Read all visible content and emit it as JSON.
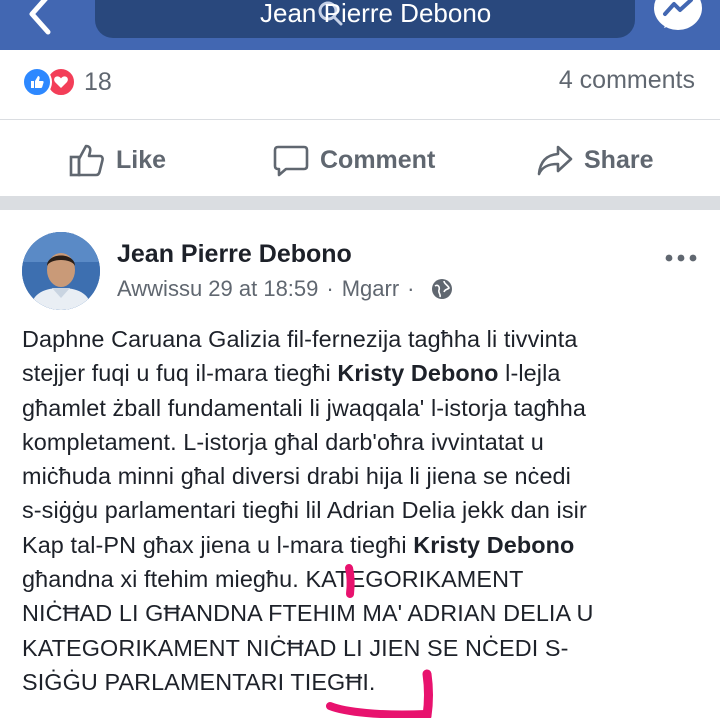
{
  "header": {
    "search_text": "Jean Pierre Debono",
    "colors": {
      "bar": "#4267b2",
      "search_box": "#29487d"
    }
  },
  "icons": [
    "back-arrow-icon",
    "search-icon",
    "messenger-icon",
    "like-reaction-icon",
    "love-reaction-icon",
    "thumbs-up-icon",
    "comment-icon",
    "share-icon",
    "globe-icon",
    "more-options-icon"
  ],
  "engagement": {
    "reaction_count": "18",
    "comments_count": "4 comments"
  },
  "actions": {
    "like": "Like",
    "comment": "Comment",
    "share": "Share"
  },
  "post": {
    "author": "Jean Pierre Debono",
    "date": "Awwissu 29 at 18:59",
    "separator": "·",
    "location": "Mgarr",
    "lines": [
      [
        "Daphne Caruana Galizia fil-fernezija tagħha li tivvinta",
        "",
        ""
      ],
      [
        "stejjer fuqi u fuq il-mara tiegħi ",
        "Kristy Debono",
        " l-lejla"
      ],
      [
        "għamlet żball fundamentali li jwaqqala' l-istorja tagħha",
        "",
        ""
      ],
      [
        "kompletament. L-istorja għal darb'oħra ivvintatat u",
        "",
        ""
      ],
      [
        "miċħuda minni għal diversi drabi hija li jiena se nċedi",
        "",
        ""
      ],
      [
        "s-siġġu parlamentari tiegħi lil Adrian Delia jekk dan isir",
        "",
        ""
      ],
      [
        "Kap tal-PN għax jiena u l-mara tiegħi ",
        "Kristy Debono",
        ""
      ],
      [
        "għandna xi ftehim miegħu. KATEGORIKAMENT",
        "",
        ""
      ],
      [
        "NIĊĦAD LI GĦANDNA FTEHIM MA' ADRIAN DELIA U",
        "",
        ""
      ],
      [
        "KATEGORIKAMENT NIĊĦAD LI JIEN SE NĊEDI S-",
        "",
        ""
      ],
      [
        "SIĠĠU PARLAMENTARI TIEGĦI.",
        "",
        ""
      ]
    ]
  },
  "colors": {
    "muted_text": "#606770",
    "reaction_like": "#2d88ff",
    "reaction_love": "#f33e58",
    "annotation_marker": "#e8126e"
  }
}
